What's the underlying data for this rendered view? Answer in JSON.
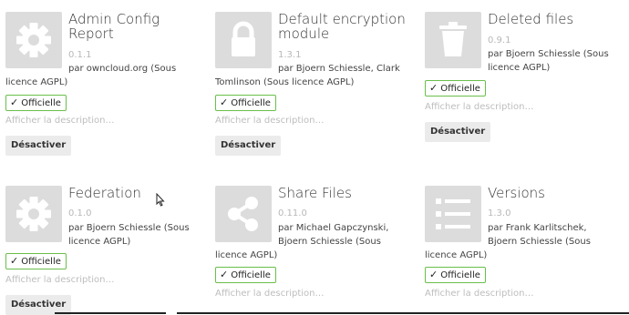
{
  "apps": [
    {
      "title": "Admin Config Report",
      "version": "0.1.1",
      "author_line1": "par owncloud.org (Sous",
      "author_line2": "licence AGPL)",
      "badge": "Officielle",
      "description_link": "Afficher la description…",
      "action_button": "Désactiver",
      "icon": "gear-icon"
    },
    {
      "title": "Default encryption module",
      "version": "1.3.1",
      "author_line1": "par Bjoern Schiessle, Clark",
      "author_line2": "Tomlinson (Sous licence AGPL)",
      "badge": "Officielle",
      "description_link": "Afficher la description…",
      "action_button": "Désactiver",
      "icon": "lock-icon"
    },
    {
      "title": "Deleted files",
      "version": "0.9.1",
      "author_line1": "par Bjoern Schiessle (Sous",
      "author_line2": "licence AGPL)",
      "badge": "Officielle",
      "description_link": "Afficher la description…",
      "action_button": "Désactiver",
      "icon": "trash-icon"
    },
    {
      "title": "Federation",
      "version": "0.1.0",
      "author_line1": "par Bjoern Schiessle (Sous",
      "author_line2": "licence AGPL)",
      "badge": "Officielle",
      "description_link": "Afficher la description…",
      "action_button": "Désactiver",
      "icon": "gear-icon"
    },
    {
      "title": "Share Files",
      "version": "0.11.0",
      "author_line1": "par Michael Gapczynski,",
      "author_line2": "Bjoern Schiessle (Sous",
      "author_line3": "licence AGPL)",
      "badge": "Officielle",
      "description_link": "Afficher la description…",
      "icon": "share-icon"
    },
    {
      "title": "Versions",
      "version": "1.3.0",
      "author_line1": "par Frank Karlitschek,",
      "author_line2": "Bjoern Schiessle (Sous",
      "author_line3": "licence AGPL)",
      "badge": "Officielle",
      "description_link": "Afficher la description…",
      "icon": "list-icon"
    }
  ]
}
